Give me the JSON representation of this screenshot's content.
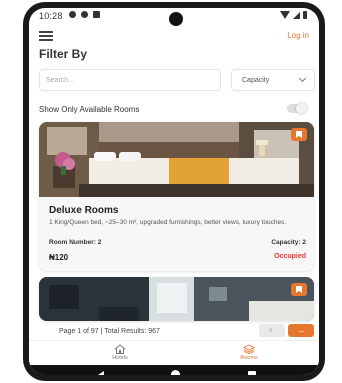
{
  "status_bar": {
    "time": "10:28"
  },
  "header": {
    "login_label": "Log in",
    "title": "Filter By"
  },
  "filters": {
    "search_placeholder": "Search...",
    "capacity_label": "Capacity",
    "toggle_label": "Show Only Available Rooms",
    "toggle_on": false
  },
  "rooms": [
    {
      "name": "Deluxe Rooms",
      "description": "1 King/Queen bed, ~25–30 m², upgraded furnishings, better views, luxury touches.",
      "room_number": "Room Number: 2",
      "capacity": "Capacity: 2",
      "price": "₦120",
      "status": "Occupied"
    }
  ],
  "pagination": {
    "text": "Page 1 of 97 | Total Results: 967",
    "next_symbol": "→"
  },
  "bottom_nav": {
    "items": [
      {
        "label": "Hotels"
      },
      {
        "label": "Rooms"
      }
    ]
  },
  "colors": {
    "accent": "#e8772e",
    "status_occupied": "#e53935"
  }
}
